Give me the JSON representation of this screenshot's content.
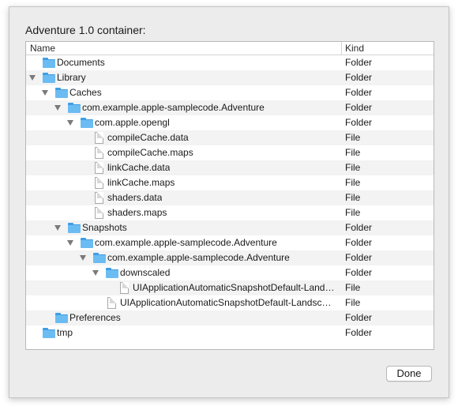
{
  "dialog": {
    "title": "Adventure 1.0 container:",
    "done_label": "Done"
  },
  "outline": {
    "columns": {
      "name": "Name",
      "kind": "Kind"
    },
    "rows": [
      {
        "label": "Documents",
        "kind": "Folder",
        "type": "folder",
        "depth": 0,
        "expanded": false
      },
      {
        "label": "Library",
        "kind": "Folder",
        "type": "folder",
        "depth": 0,
        "expanded": true
      },
      {
        "label": "Caches",
        "kind": "Folder",
        "type": "folder",
        "depth": 1,
        "expanded": true
      },
      {
        "label": "com.example.apple-samplecode.Adventure",
        "kind": "Folder",
        "type": "folder",
        "depth": 2,
        "expanded": true
      },
      {
        "label": "com.apple.opengl",
        "kind": "Folder",
        "type": "folder",
        "depth": 3,
        "expanded": true
      },
      {
        "label": "compileCache.data",
        "kind": "File",
        "type": "file",
        "depth": 4,
        "expanded": false
      },
      {
        "label": "compileCache.maps",
        "kind": "File",
        "type": "file",
        "depth": 4,
        "expanded": false
      },
      {
        "label": "linkCache.data",
        "kind": "File",
        "type": "file",
        "depth": 4,
        "expanded": false
      },
      {
        "label": "linkCache.maps",
        "kind": "File",
        "type": "file",
        "depth": 4,
        "expanded": false
      },
      {
        "label": "shaders.data",
        "kind": "File",
        "type": "file",
        "depth": 4,
        "expanded": false
      },
      {
        "label": "shaders.maps",
        "kind": "File",
        "type": "file",
        "depth": 4,
        "expanded": false
      },
      {
        "label": "Snapshots",
        "kind": "Folder",
        "type": "folder",
        "depth": 2,
        "expanded": true
      },
      {
        "label": "com.example.apple-samplecode.Adventure",
        "kind": "Folder",
        "type": "folder",
        "depth": 3,
        "expanded": true
      },
      {
        "label": "com.example.apple-samplecode.Adventure",
        "kind": "Folder",
        "type": "folder",
        "depth": 4,
        "expanded": true
      },
      {
        "label": "downscaled",
        "kind": "Folder",
        "type": "folder",
        "depth": 5,
        "expanded": true
      },
      {
        "label": "UIApplicationAutomaticSnapshotDefault-Lands…",
        "kind": "File",
        "type": "file",
        "depth": 6,
        "expanded": false
      },
      {
        "label": "UIApplicationAutomaticSnapshotDefault-Landsca…",
        "kind": "File",
        "type": "file",
        "depth": 5,
        "expanded": false
      },
      {
        "label": "Preferences",
        "kind": "Folder",
        "type": "folder",
        "depth": 1,
        "expanded": false
      },
      {
        "label": "tmp",
        "kind": "Folder",
        "type": "folder",
        "depth": 0,
        "expanded": false
      }
    ]
  }
}
